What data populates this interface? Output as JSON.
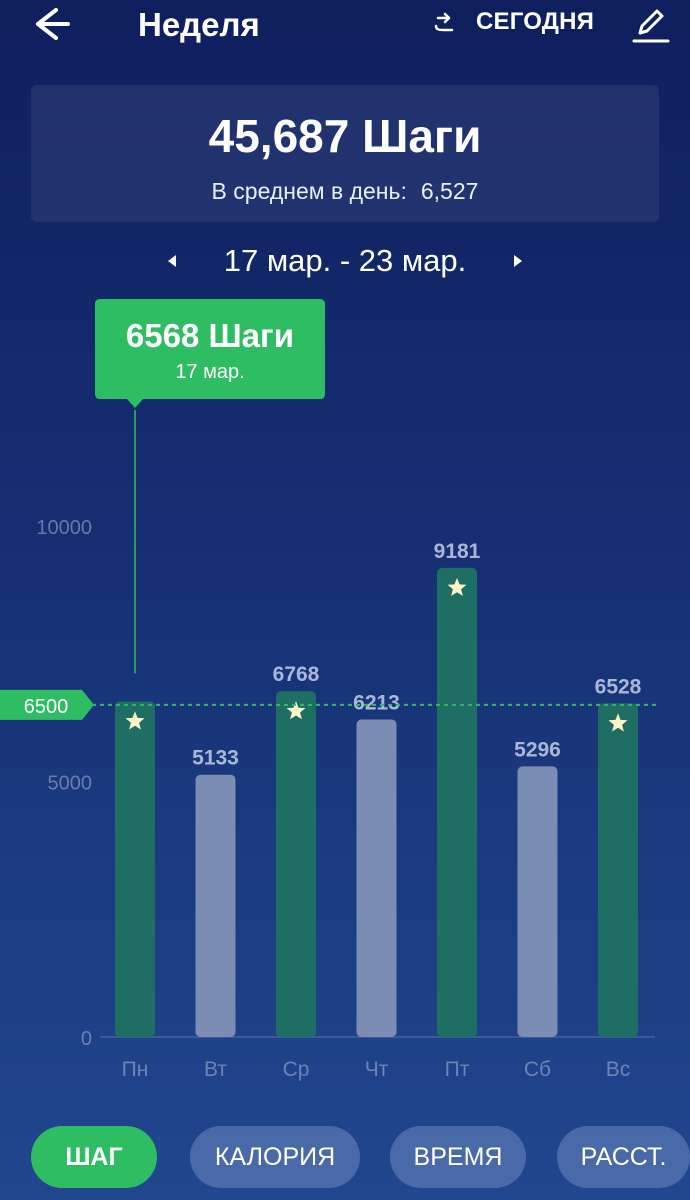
{
  "header": {
    "title": "Неделя",
    "today_label": "СЕГОДНЯ"
  },
  "summary": {
    "total": "45,687 Шаги",
    "avg_label": "В среднем в день:",
    "avg_value": "6,527"
  },
  "range": {
    "label": "17 мар. - 23 мар."
  },
  "tooltip": {
    "value": "6568 Шаги",
    "date": "17 мар."
  },
  "goal_label": "6500",
  "colors": {
    "accent": "#2ebd63",
    "goal_bar": "#1f6e63",
    "below_bar": "#7b8db4",
    "star": "#fff6c8"
  },
  "chart_data": {
    "type": "bar",
    "categories": [
      "Пн",
      "Вт",
      "Ср",
      "Чт",
      "Пт",
      "Сб",
      "Вс"
    ],
    "values": [
      6568,
      5133,
      6768,
      6213,
      9181,
      5296,
      6528
    ],
    "value_labels": [
      "",
      "5133",
      "6768",
      "6213",
      "9181",
      "5296",
      "6528"
    ],
    "goal": 6500,
    "yticks": [
      0,
      5000,
      10000
    ],
    "ylim": [
      0,
      10000
    ],
    "selected_index": 0,
    "grid": false
  },
  "tabs": [
    {
      "label": "ШАГ",
      "active": true
    },
    {
      "label": "КАЛОРИЯ",
      "active": false
    },
    {
      "label": "ВРЕМЯ",
      "active": false
    },
    {
      "label": "РАССТ.",
      "active": false
    }
  ]
}
